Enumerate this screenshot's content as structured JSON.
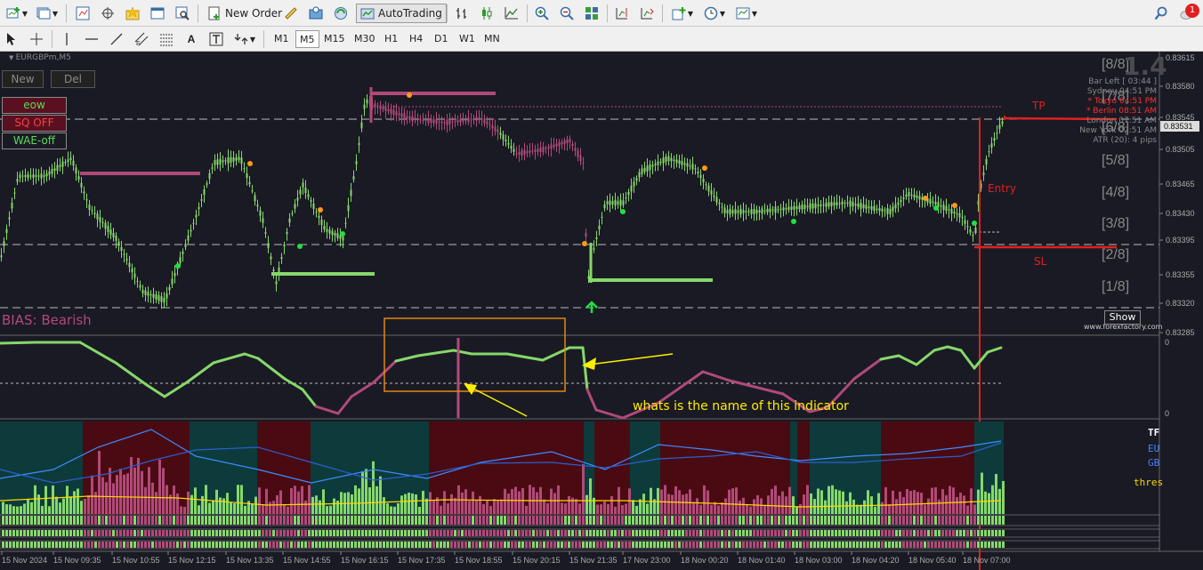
{
  "toolbar": {
    "new_order": "New Order",
    "autotrading": "AutoTrading",
    "notifications_count": "1"
  },
  "timeframes": [
    "M1",
    "M5",
    "M15",
    "M30",
    "H1",
    "H4",
    "D1",
    "W1",
    "MN"
  ],
  "timeframe_active": "M5",
  "chart": {
    "symbol_label": "EURGBPm,M5",
    "new_button": "New",
    "del_button": "Del",
    "eow_label": "eow",
    "sq_label": "SQ OFF",
    "wae_label": "WAE-off",
    "bias_label": "BIAS: Bearish",
    "show_button": "Show",
    "watermark": "www.forexfactory.com",
    "big_number": "1.4",
    "info_lines": [
      "Bar Left   [ 03:44 ]",
      "Sydney   04:51 PM",
      "* Tokyo   04:51 PM",
      "* Berlin   08:51 AM",
      "London   07:51 AM",
      "New York   02:51 AM",
      "ATR (20): 4 pips"
    ],
    "info_colors": [
      "#888888",
      "#888888",
      "#ff3030",
      "#ff3030",
      "#888888",
      "#888888",
      "#888888"
    ],
    "murrey_levels": [
      "[8/8]",
      "[7/8]",
      "[6/8]",
      "[5/8]",
      "[4/8]",
      "[3/8]",
      "[2/8]",
      "[1/8]"
    ],
    "price_scale": [
      "0.83615",
      "0.83580",
      "0.83545",
      "0.83505",
      "0.83465",
      "0.83430",
      "0.83395",
      "0.83355",
      "0.83320",
      "0.83285"
    ],
    "current_price": "0.83531",
    "tp_label": "TP",
    "entry_label": "Entry",
    "sl_label": "SL",
    "annotation_text": "whats is the name of this indicator",
    "sub1_scale": [
      "0",
      "0"
    ],
    "sub2_labels": [
      "TF",
      "EU",
      "GB",
      "thres"
    ],
    "sub2_label_colors": [
      "#ffffff",
      "#3d8bff",
      "#4a7bff",
      "#ffd700"
    ],
    "time_labels": [
      "15 Nov 2024",
      "15 Nov 09:35",
      "15 Nov 10:55",
      "15 Nov 12:15",
      "15 Nov 13:35",
      "15 Nov 14:55",
      "15 Nov 16:15",
      "15 Nov 17:35",
      "15 Nov 18:55",
      "15 Nov 20:15",
      "15 Nov 21:35",
      "17 Nov 23:00",
      "18 Nov 00:20",
      "18 Nov 01:40",
      "18 Nov 03:00",
      "18 Nov 04:20",
      "18 Nov 05:40",
      "18 Nov 07:00"
    ],
    "colors": {
      "bull": "#86d86a",
      "bear": "#b04a78",
      "orange_dot": "#ff9a1a",
      "green_dot": "#20e040",
      "red_line": "#e02020",
      "annotation_yellow": "#ffee00",
      "box_orange": "#e08a10"
    }
  }
}
